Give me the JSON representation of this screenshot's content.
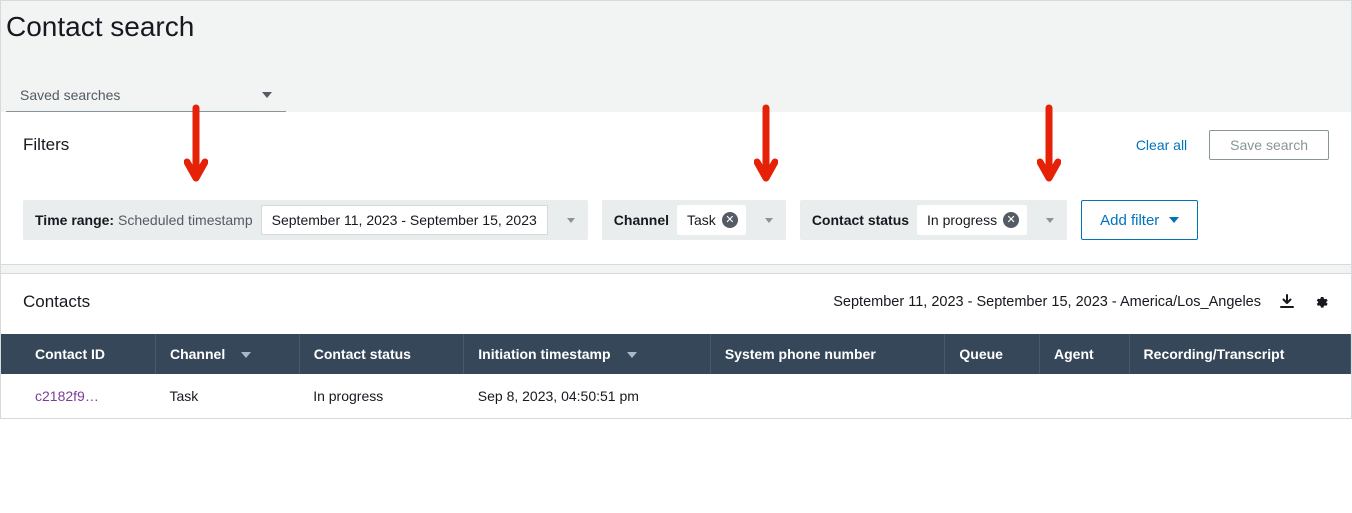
{
  "header": {
    "title": "Contact search",
    "saved_searches_label": "Saved searches"
  },
  "filters": {
    "section_title": "Filters",
    "clear_all": "Clear all",
    "save_search": "Save search",
    "time_range": {
      "label_bold": "Time range:",
      "label_rest": " Scheduled timestamp",
      "value": "September 11, 2023 - September 15, 2023"
    },
    "channel": {
      "label": "Channel",
      "value": "Task"
    },
    "contact_status": {
      "label": "Contact status",
      "value": "In progress"
    },
    "add_filter": "Add filter"
  },
  "contacts": {
    "section_title": "Contacts",
    "range_tz": "September 11, 2023 - September 15, 2023 - America/Los_Angeles",
    "columns": {
      "contact_id": "Contact ID",
      "channel": "Channel",
      "contact_status": "Contact status",
      "initiation_timestamp": "Initiation timestamp",
      "system_phone": "System phone number",
      "queue": "Queue",
      "agent": "Agent",
      "recording": "Recording/Transcript"
    },
    "rows": [
      {
        "contact_id": "c2182f9…",
        "channel": "Task",
        "contact_status": "In progress",
        "initiation_timestamp": "Sep 8, 2023, 04:50:51 pm",
        "system_phone": "",
        "queue": "",
        "agent": "",
        "recording": ""
      }
    ]
  }
}
